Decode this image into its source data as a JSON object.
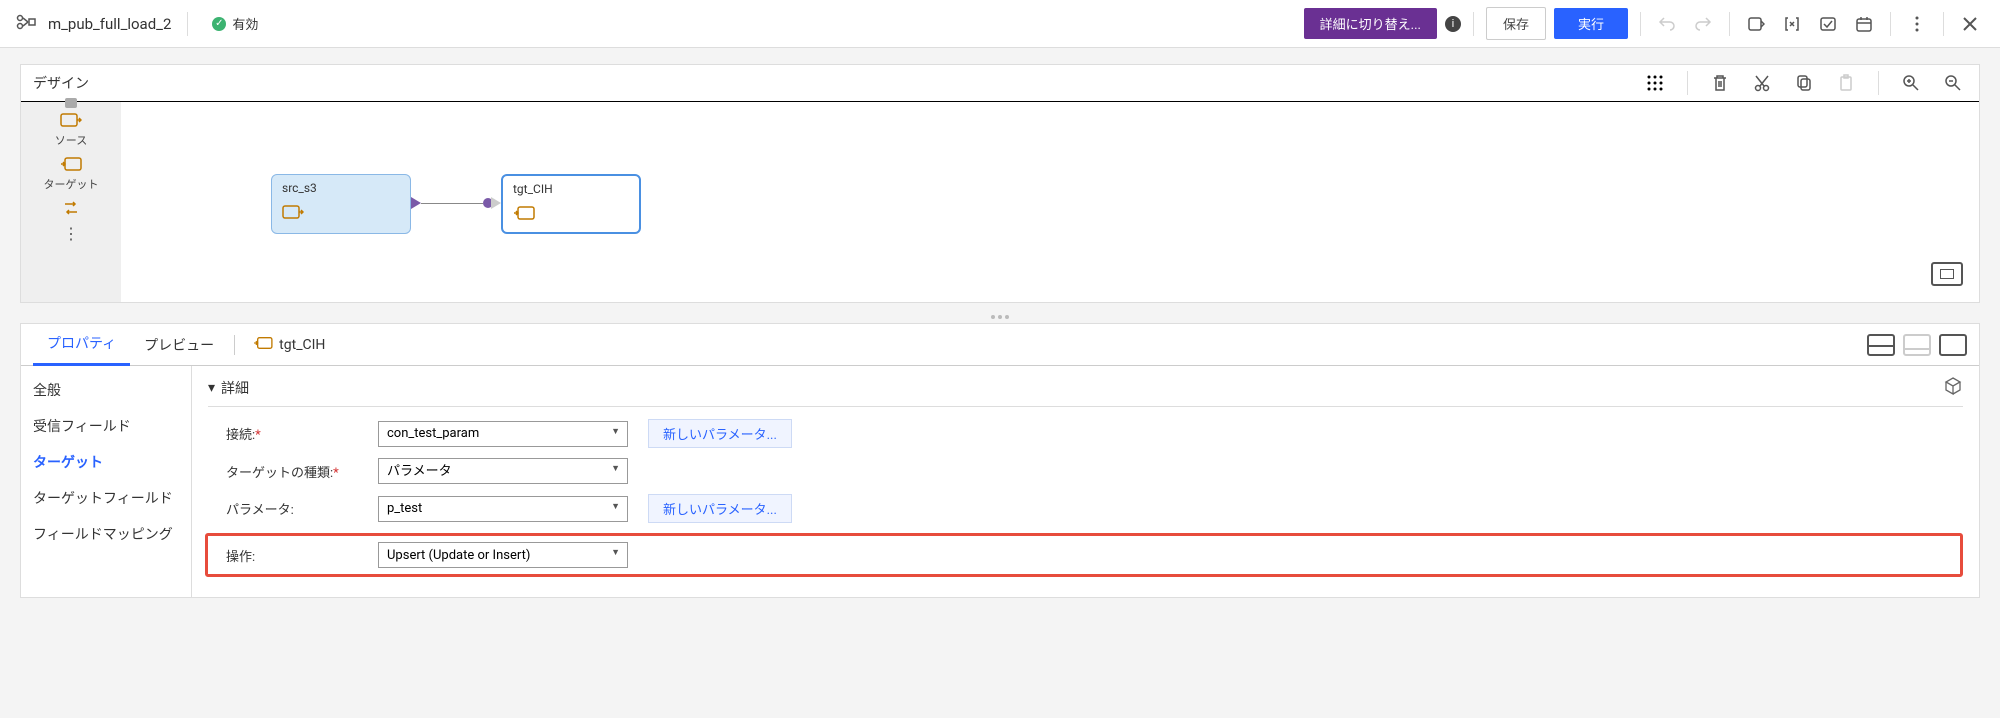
{
  "header": {
    "title": "m_pub_full_load_2",
    "status": "有効",
    "buttons": {
      "switch_detail": "詳細に切り替え...",
      "save": "保存",
      "run": "実行"
    }
  },
  "design": {
    "title": "デザイン",
    "palette": [
      {
        "label": "ソース"
      },
      {
        "label": "ターゲット"
      }
    ],
    "nodes": {
      "src": "src_s3",
      "tgt": "tgt_CIH"
    }
  },
  "properties": {
    "tabs": {
      "property": "プロパティ",
      "preview": "プレビュー"
    },
    "selected_node": "tgt_CIH",
    "nav": {
      "general": "全般",
      "incoming": "受信フィールド",
      "target": "ターゲット",
      "target_field": "ターゲットフィールド",
      "field_mapping": "フィールドマッピング"
    },
    "detail": {
      "header": "詳細",
      "connection_label": "接続:",
      "connection_value": "con_test_param",
      "target_type_label": "ターゲットの種類:",
      "target_type_value": "パラメータ",
      "parameter_label": "パラメータ:",
      "parameter_value": "p_test",
      "operation_label": "操作:",
      "operation_value": "Upsert (Update or Insert)",
      "new_param": "新しいパラメータ..."
    }
  }
}
